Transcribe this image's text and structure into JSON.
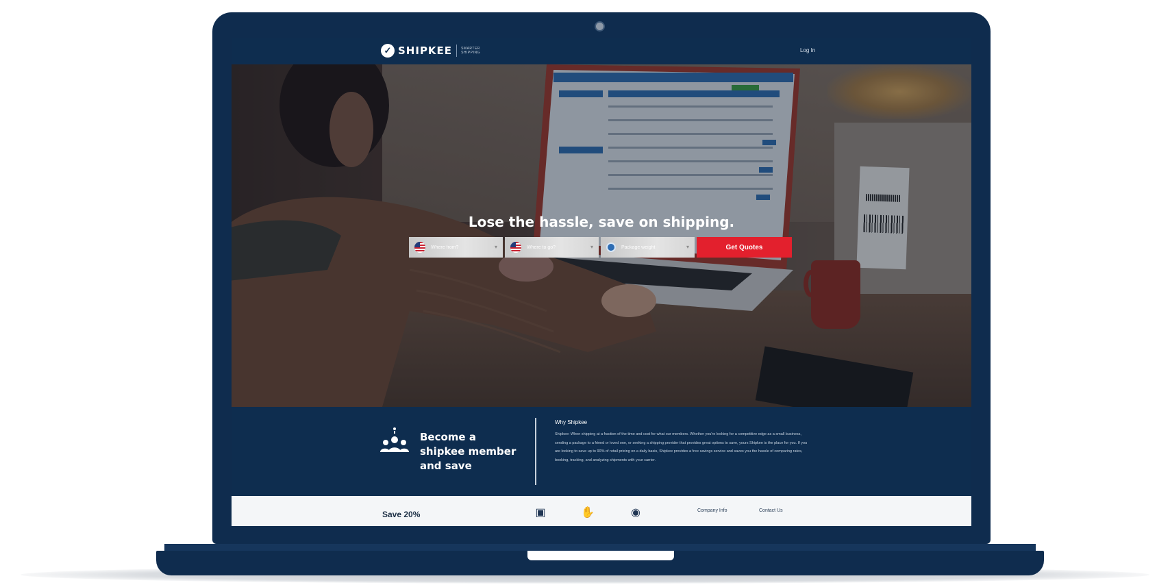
{
  "brand": {
    "name": "SHIPKEE",
    "tagline": "SMARTER SHIPPING"
  },
  "nav": {
    "login": "Log In"
  },
  "hero": {
    "headline": "Lose the hassle, save on shipping.",
    "fields": [
      {
        "text": "Where from?",
        "icon": "us-flag-icon"
      },
      {
        "text": "Where to go?",
        "icon": "us-flag-icon"
      },
      {
        "text": "Package weight",
        "icon": "package-icon"
      }
    ],
    "cta": "Get Quotes"
  },
  "member": {
    "title": "Become a shipkee member and save",
    "why_title": "Why Shipkee",
    "why_body": "Shipkee: When shipping at a fraction of the time and cost for what our members. Whether you're looking for a competitive edge as a small business, sending a package to a friend or loved one, or seeking a shipping provider that provides great options to save, yours Shipkee is the place for you. If you are looking to save up to 90% of retail pricing on a daily basis, Shipkee provides a free savings service and saves you the hassle of comparing rates, booking, tracking, and analyzing shipments with your carrier."
  },
  "footer": {
    "save": "Save 20%",
    "icons": [
      "calendar-icon",
      "handshake-icon",
      "piggy-bank-icon"
    ],
    "links": [
      "Company Info",
      "Contact Us"
    ]
  },
  "colors": {
    "navy": "#0e2d4f",
    "cta_red": "#e3202d",
    "footer_bg": "#f4f6f8"
  }
}
